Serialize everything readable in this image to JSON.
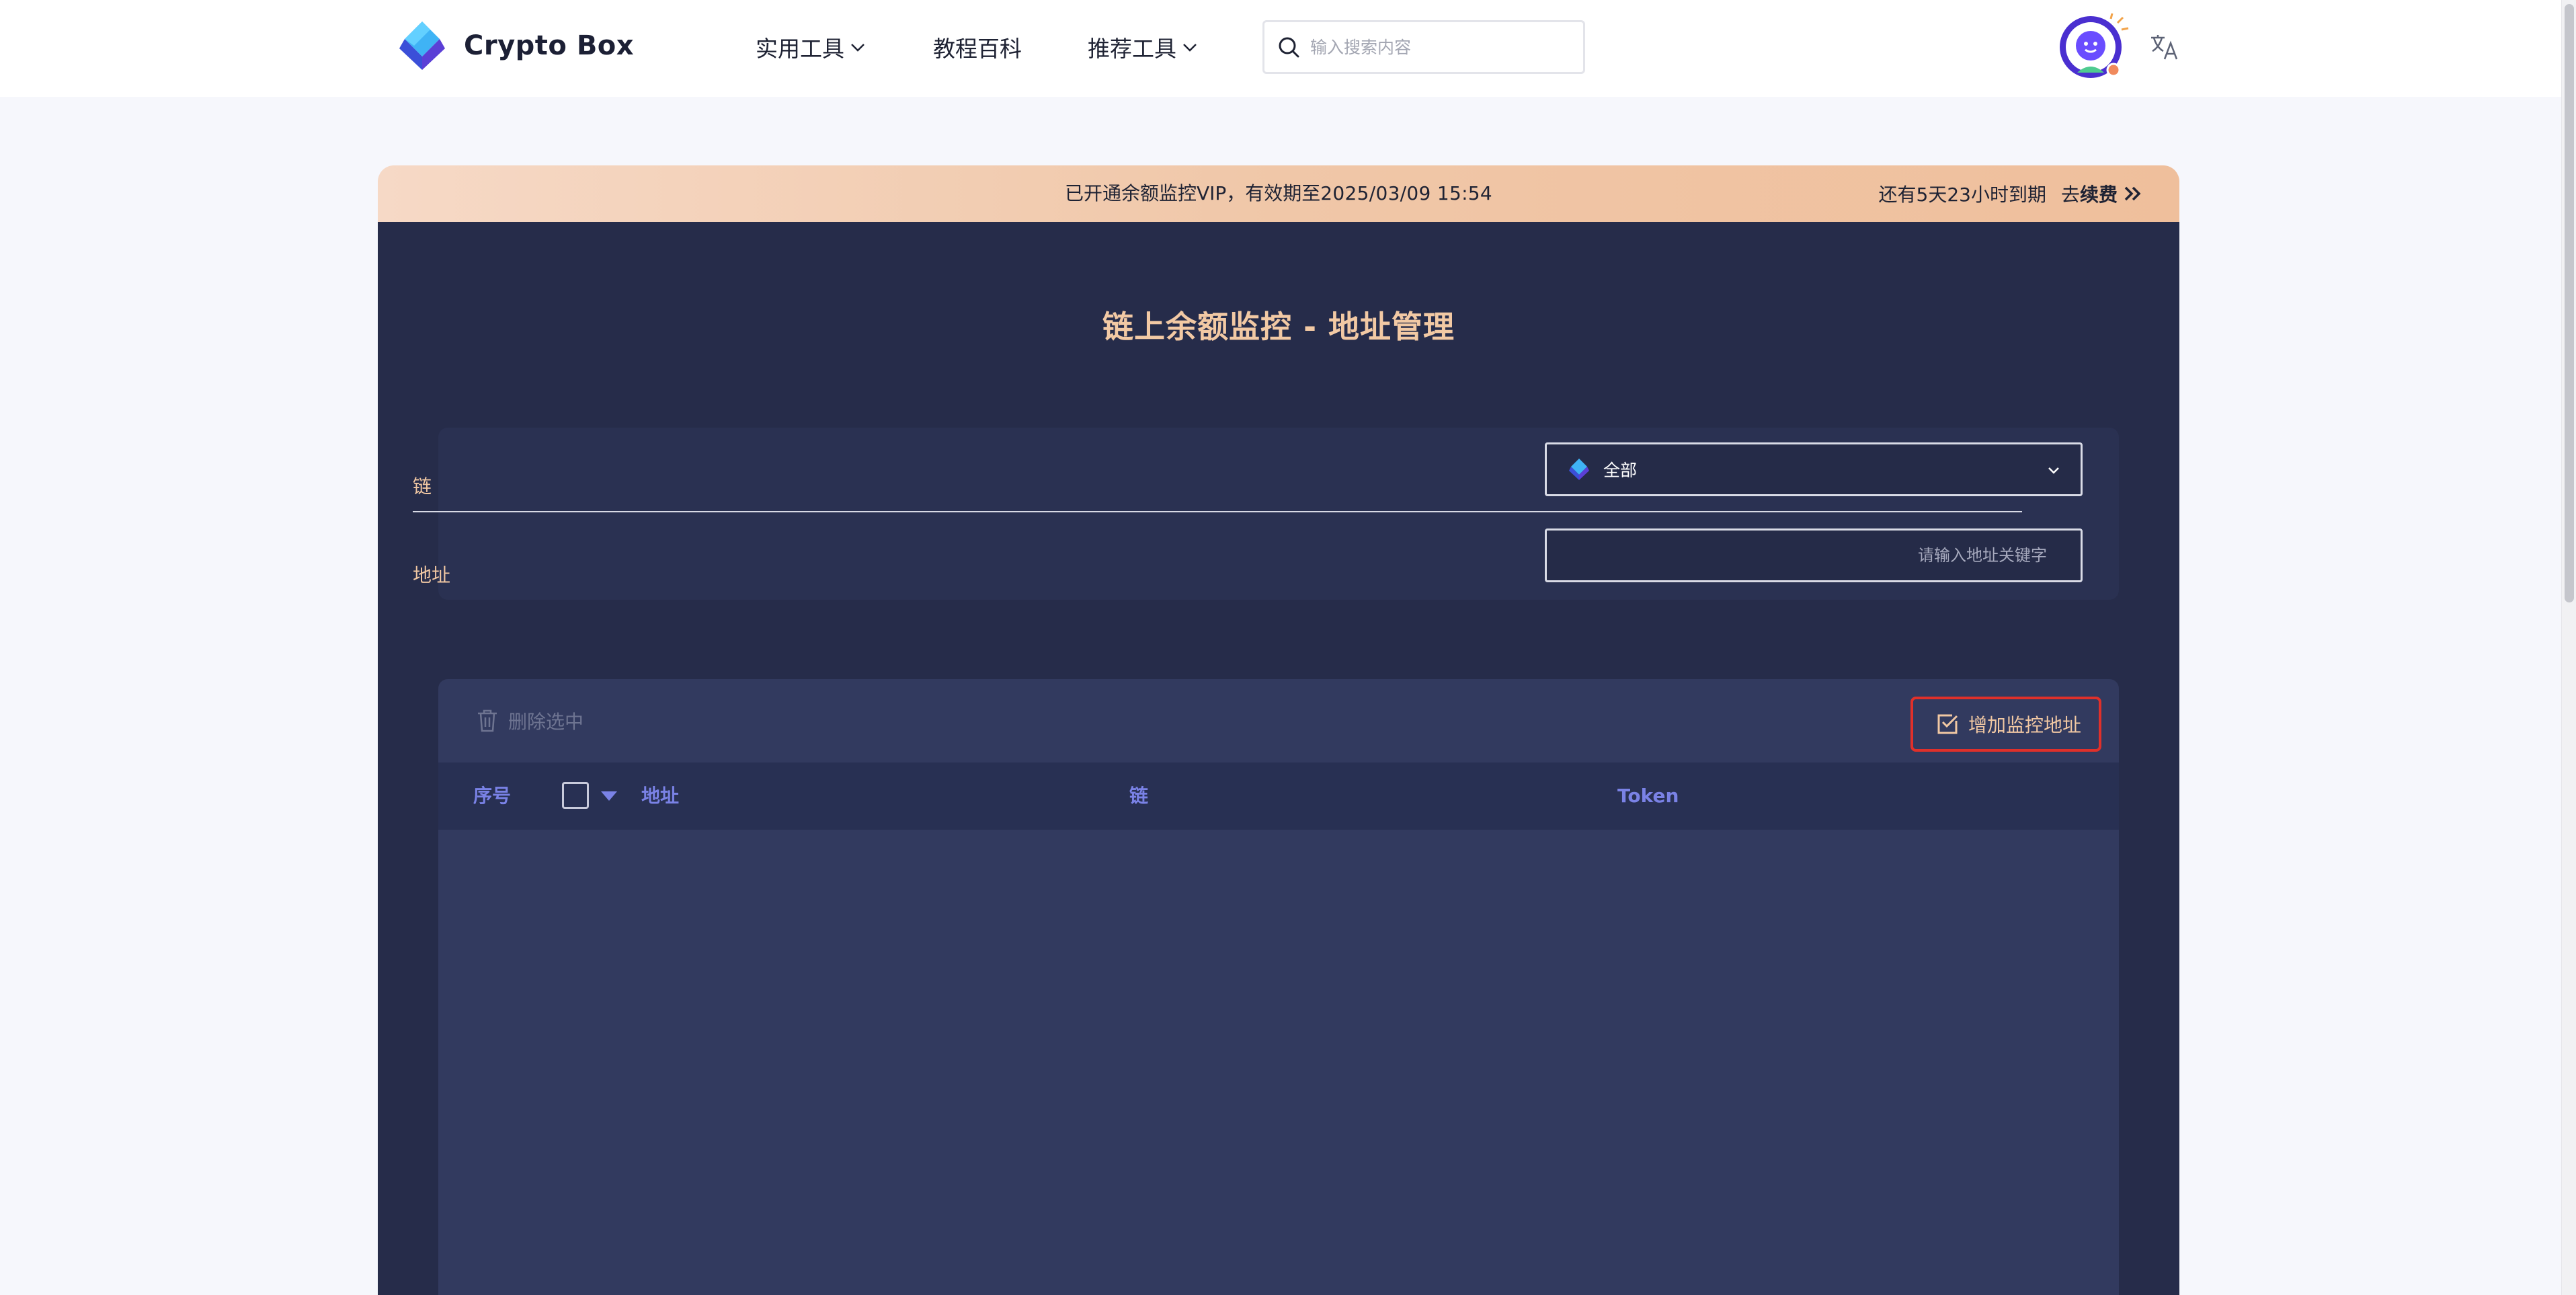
{
  "header": {
    "logo_text": "Crypto Box",
    "nav": {
      "tools": "实用工具",
      "wiki": "教程百科",
      "recommended": "推荐工具"
    },
    "search_placeholder": "输入搜索内容",
    "avatar_icon": "avatar-icon",
    "translate_icon": "translate-icon"
  },
  "vip_banner": {
    "status_text": "已开通余额监控VIP，有效期至",
    "expiry": "2025/03/09 15:54",
    "remaining": "还有5天23小时到期",
    "renew_prefix": "去",
    "renew_label": "续费"
  },
  "page": {
    "title": "链上余额监控 - 地址管理"
  },
  "filters": {
    "chain_label": "链",
    "chain_value": "全部",
    "address_label": "地址",
    "address_placeholder": "请输入地址关键字"
  },
  "toolbar": {
    "delete_label": "删除选中",
    "add_label": "增加监控地址"
  },
  "table": {
    "columns": [
      "序号",
      "地址",
      "链",
      "Token"
    ],
    "rows": []
  },
  "colors": {
    "panel_bg": "#262c4a",
    "title_accent": "#f2c9a4",
    "column_header": "#7a82e6",
    "highlight_border": "#e0302a"
  }
}
